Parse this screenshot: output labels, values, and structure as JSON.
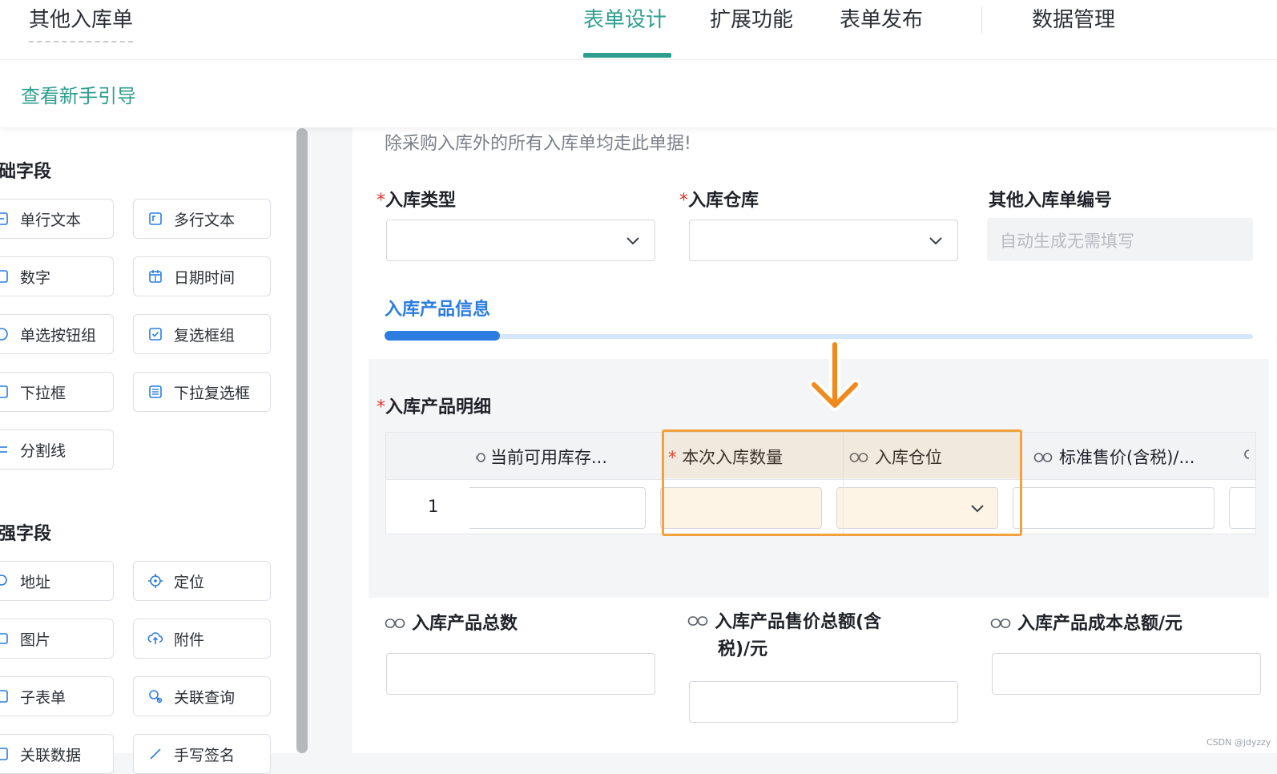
{
  "header": {
    "app_title": "其他入库单",
    "tabs": [
      {
        "label": "表单设计",
        "active": true
      },
      {
        "label": "扩展功能",
        "active": false
      },
      {
        "label": "表单发布",
        "active": false
      },
      {
        "label": "数据管理",
        "active": false
      }
    ]
  },
  "guide": {
    "label": "查看新手引导"
  },
  "sidebar": {
    "basic_section": "础字段",
    "basic_fields": [
      {
        "label": "单行文本",
        "icon": "text-line-icon"
      },
      {
        "label": "多行文本",
        "icon": "text-multiline-icon"
      },
      {
        "label": "数字",
        "icon": "number-icon"
      },
      {
        "label": "日期时间",
        "icon": "calendar-icon"
      },
      {
        "label": "单选按钮组",
        "icon": "radio-icon"
      },
      {
        "label": "复选框组",
        "icon": "checkbox-icon"
      },
      {
        "label": "下拉框",
        "icon": "dropdown-icon"
      },
      {
        "label": "下拉复选框",
        "icon": "dropdown-checkbox-icon"
      },
      {
        "label": "分割线",
        "icon": "divider-icon"
      }
    ],
    "advanced_section": "强字段",
    "advanced_fields": [
      {
        "label": "地址",
        "icon": "address-icon"
      },
      {
        "label": "定位",
        "icon": "location-icon"
      },
      {
        "label": "图片",
        "icon": "image-icon"
      },
      {
        "label": "附件",
        "icon": "attachment-icon"
      },
      {
        "label": "子表单",
        "icon": "subform-icon"
      },
      {
        "label": "关联查询",
        "icon": "related-query-icon"
      },
      {
        "label": "关联数据",
        "icon": "related-data-icon"
      },
      {
        "label": "手写签名",
        "icon": "signature-icon"
      }
    ]
  },
  "form": {
    "description": "除采购入库外的所有入库单均走此单据!",
    "required_mark": "*",
    "fields": {
      "type_label": "入库类型",
      "warehouse_label": "入库仓库",
      "number_label": "其他入库单编号",
      "number_placeholder": "自动生成无需填写"
    },
    "product_tab": "入库产品信息",
    "detail_label": "入库产品明细",
    "table": {
      "columns": [
        {
          "label": "当前可用库存..."
        },
        {
          "label": "本次入库数量",
          "required": true
        },
        {
          "label": "入库仓位"
        },
        {
          "label": "标准售价(含税)/..."
        }
      ],
      "rows": [
        {
          "index": "1"
        }
      ]
    },
    "summary": {
      "total_count_label": "入库产品总数",
      "sale_total_label_line1": "入库产品售价总额(含",
      "sale_total_label_line2": "税)/元",
      "cost_total_label": "入库产品成本总额/元"
    }
  },
  "watermark": "CSDN @jdyzzy",
  "colors": {
    "brand_green": "#2f9e8f",
    "accent_blue": "#2b7de0",
    "highlight_orange": "#f2a23c",
    "required_red": "#e0362c"
  }
}
